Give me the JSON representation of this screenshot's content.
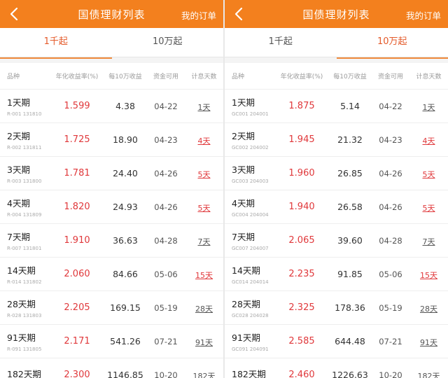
{
  "colors": {
    "header_bg": "#f3801e",
    "rate_red": "#e0383b",
    "tab_active": "#e45a2a"
  },
  "panes": [
    {
      "header": {
        "back_icon": "chevron-left-icon",
        "title": "国债理财列表",
        "orders": "我的订单"
      },
      "tabs": [
        "1千起",
        "10万起"
      ],
      "active_tab": 0,
      "columns": [
        "品种",
        "年化收益率(%)",
        "每10万收益",
        "资金可用",
        "计息天数"
      ],
      "rows": [
        {
          "name": "1天期",
          "code": "R-001 131810",
          "rate": "1.599",
          "income": "4.38",
          "date": "04-22",
          "days": "1天",
          "days_red": false
        },
        {
          "name": "2天期",
          "code": "R-002 131811",
          "rate": "1.725",
          "income": "18.90",
          "date": "04-23",
          "days": "4天",
          "days_red": true
        },
        {
          "name": "3天期",
          "code": "R-003 131800",
          "rate": "1.781",
          "income": "24.40",
          "date": "04-26",
          "days": "5天",
          "days_red": true
        },
        {
          "name": "4天期",
          "code": "R-004 131809",
          "rate": "1.820",
          "income": "24.93",
          "date": "04-26",
          "days": "5天",
          "days_red": true
        },
        {
          "name": "7天期",
          "code": "R-007 131801",
          "rate": "1.910",
          "income": "36.63",
          "date": "04-28",
          "days": "7天",
          "days_red": false
        },
        {
          "name": "14天期",
          "code": "R-014 131802",
          "rate": "2.060",
          "income": "84.66",
          "date": "05-06",
          "days": "15天",
          "days_red": true
        },
        {
          "name": "28天期",
          "code": "R-028 131803",
          "rate": "2.205",
          "income": "169.15",
          "date": "05-19",
          "days": "28天",
          "days_red": false
        },
        {
          "name": "91天期",
          "code": "R-091 131805",
          "rate": "2.171",
          "income": "541.26",
          "date": "07-21",
          "days": "91天",
          "days_red": false
        },
        {
          "name": "182天期",
          "code": "",
          "rate": "2.300",
          "income": "1146.85",
          "date": "10-20",
          "days": "182天",
          "days_red": false
        }
      ]
    },
    {
      "header": {
        "back_icon": "chevron-left-icon",
        "title": "国债理财列表",
        "orders": "我的订单"
      },
      "tabs": [
        "1千起",
        "10万起"
      ],
      "active_tab": 1,
      "columns": [
        "品种",
        "年化收益率(%)",
        "每10万收益",
        "资金可用",
        "计息天数"
      ],
      "rows": [
        {
          "name": "1天期",
          "code": "GC001 204001",
          "rate": "1.875",
          "income": "5.14",
          "date": "04-22",
          "days": "1天",
          "days_red": false
        },
        {
          "name": "2天期",
          "code": "GC002 204002",
          "rate": "1.945",
          "income": "21.32",
          "date": "04-23",
          "days": "4天",
          "days_red": true
        },
        {
          "name": "3天期",
          "code": "GC003 204003",
          "rate": "1.960",
          "income": "26.85",
          "date": "04-26",
          "days": "5天",
          "days_red": true
        },
        {
          "name": "4天期",
          "code": "GC004 204004",
          "rate": "1.940",
          "income": "26.58",
          "date": "04-26",
          "days": "5天",
          "days_red": true
        },
        {
          "name": "7天期",
          "code": "GC007 204007",
          "rate": "2.065",
          "income": "39.60",
          "date": "04-28",
          "days": "7天",
          "days_red": false
        },
        {
          "name": "14天期",
          "code": "GC014 204014",
          "rate": "2.235",
          "income": "91.85",
          "date": "05-06",
          "days": "15天",
          "days_red": true
        },
        {
          "name": "28天期",
          "code": "GC028 204028",
          "rate": "2.325",
          "income": "178.36",
          "date": "05-19",
          "days": "28天",
          "days_red": false
        },
        {
          "name": "91天期",
          "code": "GC091 204091",
          "rate": "2.585",
          "income": "644.48",
          "date": "07-21",
          "days": "91天",
          "days_red": false
        },
        {
          "name": "182天期",
          "code": "",
          "rate": "2.460",
          "income": "1226.63",
          "date": "10-20",
          "days": "182天",
          "days_red": false
        }
      ]
    }
  ]
}
